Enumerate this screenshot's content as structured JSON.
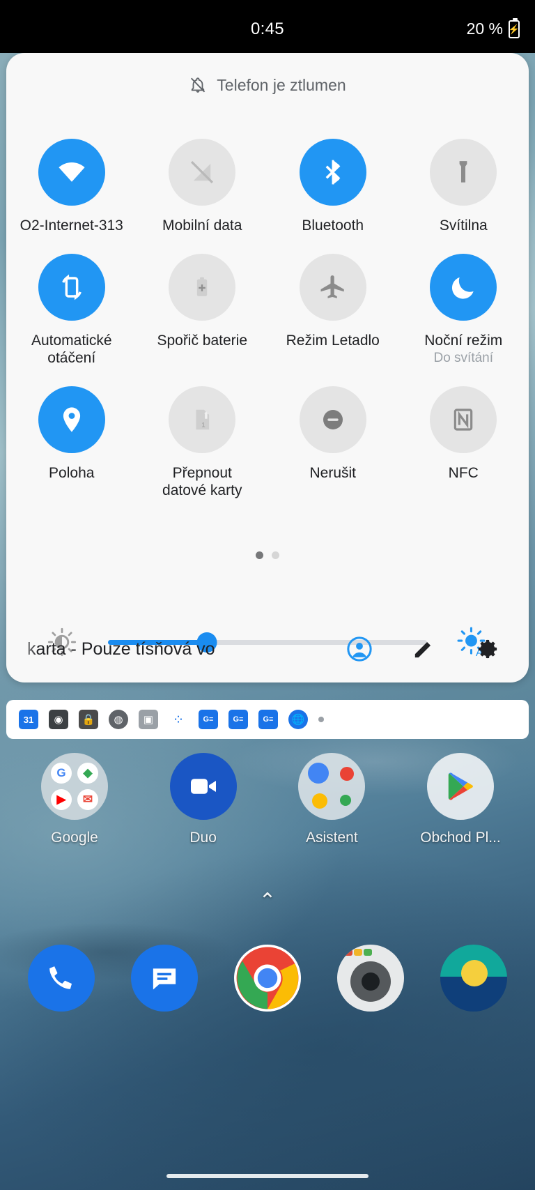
{
  "status_bar": {
    "time": "0:45",
    "battery_percent": "20 %",
    "battery_icon": "battery-charging-icon"
  },
  "quick_settings": {
    "silent_banner": {
      "icon": "bell-slash-icon",
      "text": "Telefon je ztlumen"
    },
    "tiles": [
      {
        "label": "O2-Internet-313",
        "sub": "",
        "icon": "wifi-icon",
        "active": true
      },
      {
        "label": "Mobilní data",
        "sub": "",
        "icon": "mobile-data-off-icon",
        "active": false
      },
      {
        "label": "Bluetooth",
        "sub": "",
        "icon": "bluetooth-icon",
        "active": true
      },
      {
        "label": "Svítilna",
        "sub": "",
        "icon": "flashlight-icon",
        "active": false
      },
      {
        "label": "Automatické otáčení",
        "sub": "",
        "icon": "auto-rotate-icon",
        "active": true
      },
      {
        "label": "Spořič baterie",
        "sub": "",
        "icon": "battery-saver-icon",
        "active": false
      },
      {
        "label": "Režim Letadlo",
        "sub": "",
        "icon": "airplane-icon",
        "active": false
      },
      {
        "label": "Noční režim",
        "sub": "Do svítání",
        "icon": "moon-icon",
        "active": true
      },
      {
        "label": "Poloha",
        "sub": "",
        "icon": "location-pin-icon",
        "active": true
      },
      {
        "label": "Přepnout datové karty",
        "sub": "",
        "icon": "sim-swap-icon",
        "active": false
      },
      {
        "label": "Nerušit",
        "sub": "",
        "icon": "do-not-disturb-icon",
        "active": false
      },
      {
        "label": "NFC",
        "sub": "",
        "icon": "nfc-icon",
        "active": false
      }
    ],
    "pager": {
      "pages": 2,
      "active_page": 1
    },
    "brightness": {
      "value_percent": 31,
      "low_icon": "brightness-low-icon",
      "auto_icon": "brightness-auto-icon"
    },
    "footer": {
      "carrier_text": "karta - Pouze tísňová vo",
      "user_icon": "user-avatar-icon",
      "edit_icon": "pencil-edit-icon",
      "settings_icon": "gear-icon"
    },
    "accent_color": "#2196f3",
    "panel_color": "#f8f8f8"
  },
  "notification_shelf": {
    "icons": [
      "calendar-31-icon",
      "camera-aperture-icon",
      "lock-icon",
      "brain-icon",
      "photo-icon",
      "google-assistant-dots-icon",
      "gmail-ge-icon",
      "gmail-ge-icon-2",
      "gmail-ge-icon-3",
      "globe-icon"
    ],
    "overflow_dot": "more-notifications-dot"
  },
  "home_screen": {
    "apps": [
      {
        "name": "Google",
        "icon": "google-folder-icon"
      },
      {
        "name": "Duo",
        "icon": "duo-icon"
      },
      {
        "name": "Asistent",
        "icon": "assistant-icon"
      },
      {
        "name": "Obchod Pl...",
        "icon": "play-store-icon"
      }
    ],
    "app_drawer_handle": "chevron-up-icon",
    "dock": [
      {
        "name": "phone-icon"
      },
      {
        "name": "messages-icon"
      },
      {
        "name": "chrome-icon"
      },
      {
        "name": "camera-icon"
      },
      {
        "name": "weather-icon"
      }
    ],
    "nav_pill": "gesture-nav-pill"
  }
}
